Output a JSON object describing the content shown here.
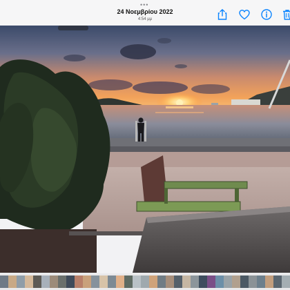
{
  "header": {
    "dots": "•••",
    "date": "24 Νοεμβρίου 2022",
    "time": "4:54 μμ",
    "actions": [
      {
        "name": "share-button",
        "icon": "share-icon"
      },
      {
        "name": "favorite-button",
        "icon": "heart-icon"
      },
      {
        "name": "info-button",
        "icon": "info-icon"
      },
      {
        "name": "delete-button",
        "icon": "trash-icon"
      }
    ]
  },
  "photo": {
    "subject": "sunset-over-harbor"
  },
  "colors": {
    "accent": "#0a84ff",
    "toolbar_bg": "#f6f6f7"
  },
  "filmstrip": {
    "thumbnails": [
      "#6f7a86",
      "#c8a986",
      "#8f9da8",
      "#d4b89a",
      "#5d5a55",
      "#a7b0ba",
      "#9c8b7a",
      "#6a6f6c",
      "#3f4a5a",
      "#b87f6a",
      "#c9a17c",
      "#86929c",
      "#d7c3a8",
      "#7d8a94",
      "#e0b089",
      "#5f6b63",
      "#b9c1c6",
      "#9fa9ae",
      "#cfa37a",
      "#707c84",
      "#a68e7b",
      "#55606a",
      "#c5b6a3",
      "#8c959b",
      "#3e4d5e",
      "#7a4f87",
      "#6c8fa8",
      "#9aa3a8",
      "#b1a08e",
      "#4c5964",
      "#8b9296",
      "#6d7f8c",
      "#c29e7e",
      "#5a6670",
      "#a4aeb3"
    ]
  }
}
